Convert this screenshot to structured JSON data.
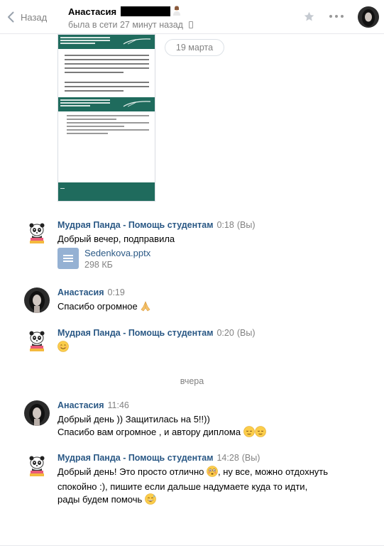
{
  "header": {
    "back_label": "Назад",
    "peer_name": "Анастасия",
    "peer_status": "была в сети 27 минут назад"
  },
  "dates": {
    "pill": "19 марта",
    "divider": "вчера"
  },
  "messages": [
    {
      "author": "Мудрая Панда - Помощь студентам",
      "time": "0:18",
      "you": "(Вы)",
      "text": "Добрый вечер, подправила",
      "attachment": {
        "name": "Sedenkova.pptx",
        "size": "298 КБ",
        "icon": "document-icon"
      }
    },
    {
      "author": "Анастасия",
      "time": "0:19",
      "text": "Спасибо огромное",
      "emoji": "folded-hands"
    },
    {
      "author": "Мудрая Панда - Помощь студентам",
      "time": "0:20",
      "you": "(Вы)",
      "emoji": "smiling-face"
    },
    {
      "author": "Анастасия",
      "time": "11:46",
      "lines": [
        "Добрый день )) Защитилась на 5!!))",
        "Спасибо вам огромное , и автору диплома"
      ],
      "emoji": "relieved-face"
    },
    {
      "author": "Мудрая Панда - Помощь студентам",
      "time": "14:28",
      "you": "(Вы)",
      "lines": [
        "Добрый день! Это просто отлично",
        ", ну все, можно отдохнуть",
        "спокойно :), пишите если дальше надумаете куда то идти,",
        "рады будем помочь"
      ],
      "emoji": [
        "flushed-face",
        "grinning-sweat-face"
      ]
    }
  ],
  "colors": {
    "link": "#2a5885",
    "muted": "#828282",
    "slide_green": "#1f6b5d",
    "doc_icon": "#95b1d3"
  }
}
